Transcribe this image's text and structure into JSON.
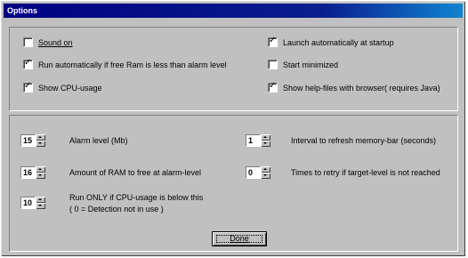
{
  "window": {
    "title": "Options"
  },
  "checkboxes": {
    "sound_on": {
      "label": "Sound on",
      "checked": false
    },
    "run_auto": {
      "label": "Run automatically if free Ram is less than alarm level",
      "checked": true
    },
    "show_cpu": {
      "label": "Show CPU-usage",
      "checked": true
    },
    "launch_startup": {
      "label": "Launch automatically at startup",
      "checked": true
    },
    "start_minimized": {
      "label": "Start minimized",
      "checked": false
    },
    "help_files": {
      "label": "Show help-files with browser( requires Java)",
      "checked": true
    }
  },
  "spinners": {
    "alarm_level": {
      "value": "15",
      "label": "Alarm level (Mb)"
    },
    "ram_free": {
      "value": "16",
      "label": "Amount of RAM to free at alarm-level"
    },
    "cpu_limit": {
      "value": "10",
      "label": "Run ONLY if CPU-usage is below this",
      "note": "( 0 = Detection not in use )"
    },
    "refresh_interval": {
      "value": "1",
      "label": "Interval to refresh memory-bar (seconds)"
    },
    "retry_times": {
      "value": "0",
      "label": "Times to retry if target-level is not reached"
    }
  },
  "buttons": {
    "done": "Done"
  }
}
